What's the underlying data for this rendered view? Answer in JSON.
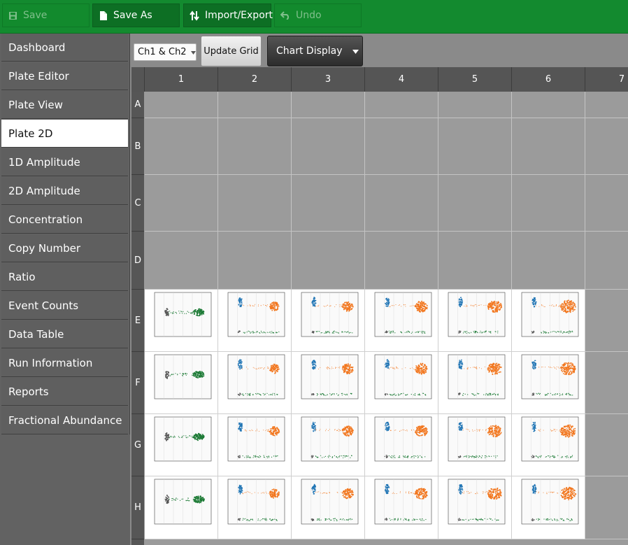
{
  "toolbar": {
    "save_label": "Save",
    "save_as_label": "Save As",
    "import_export_label": "Import/Export",
    "undo_label": "Undo"
  },
  "sidebar": {
    "items": [
      {
        "label": "Dashboard"
      },
      {
        "label": "Plate Editor"
      },
      {
        "label": "Plate View"
      },
      {
        "label": "Plate 2D",
        "active": true
      },
      {
        "label": "1D Amplitude"
      },
      {
        "label": "2D Amplitude"
      },
      {
        "label": "Concentration"
      },
      {
        "label": "Copy Number"
      },
      {
        "label": "Ratio"
      },
      {
        "label": "Event Counts"
      },
      {
        "label": "Data Table"
      },
      {
        "label": "Run Information"
      },
      {
        "label": "Reports"
      },
      {
        "label": "Fractional Abundance"
      }
    ]
  },
  "controls": {
    "channel_value": "Ch1 & Ch2",
    "update_grid_label": "Update Grid",
    "chart_display_label": "Chart Display"
  },
  "grid": {
    "columns": [
      "1",
      "2",
      "3",
      "4",
      "5",
      "6",
      "7"
    ],
    "rows": [
      "A",
      "B",
      "C",
      "D",
      "E",
      "F",
      "G",
      "H"
    ],
    "filled_rows": [
      "E",
      "F",
      "G",
      "H"
    ],
    "filled_columns": [
      "1",
      "2",
      "3",
      "4",
      "5",
      "6"
    ]
  },
  "colors": {
    "toolbar_green": "#138a2f",
    "cluster_blue": "#1f74b4",
    "cluster_orange": "#f2771f",
    "cluster_green": "#1c7a35",
    "cluster_gray": "#555555"
  }
}
